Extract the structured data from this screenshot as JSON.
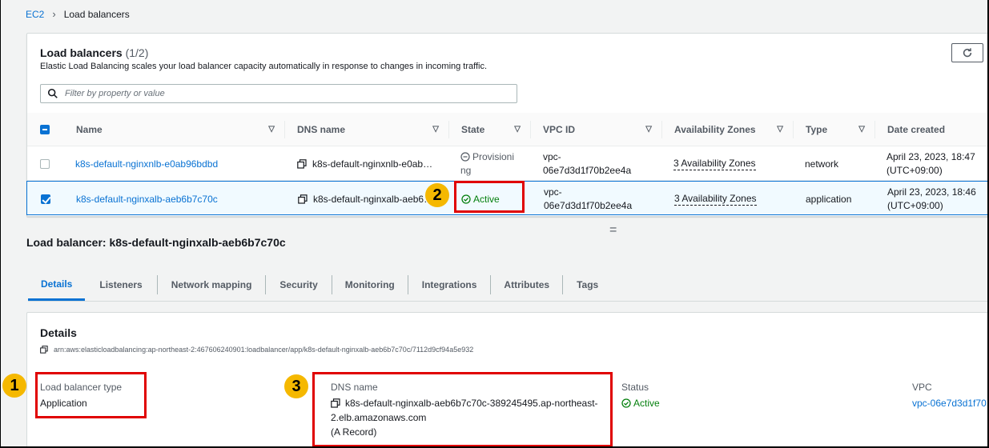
{
  "breadcrumb": {
    "root": "EC2",
    "current": "Load balancers"
  },
  "list": {
    "title": "Load balancers",
    "count": "(1/2)",
    "description": "Elastic Load Balancing scales your load balancer capacity automatically in response to changes in incoming traffic.",
    "filter_placeholder": "Filter by property or value",
    "columns": [
      "Name",
      "DNS name",
      "State",
      "VPC ID",
      "Availability Zones",
      "Type",
      "Date created"
    ],
    "rows": [
      {
        "name": "k8s-default-nginxnlb-e0ab96bdbd",
        "dns": "k8s-default-nginxnlb-e0ab…",
        "state_line1": "Provisioni",
        "state_line2": "ng",
        "vpc_line1": "vpc-",
        "vpc_line2": "06e7d3d1f70b2ee4a",
        "az": "3 Availability Zones",
        "type": "network",
        "date_line1": "April 23, 2023, 18:47",
        "date_line2": "(UTC+09:00)",
        "selected": false
      },
      {
        "name": "k8s-default-nginxalb-aeb6b7c70c",
        "dns": "k8s-default-nginxalb-aeb6…",
        "state": "Active",
        "vpc_line1": "vpc-",
        "vpc_line2": "06e7d3d1f70b2ee4a",
        "az": "3 Availability Zones",
        "type": "application",
        "date_line1": "April 23, 2023, 18:46",
        "date_line2": "(UTC+09:00)",
        "selected": true
      }
    ]
  },
  "detail": {
    "title": "Load balancer: k8s-default-nginxalb-aeb6b7c70c",
    "tabs": [
      "Details",
      "Listeners",
      "Network mapping",
      "Security",
      "Monitoring",
      "Integrations",
      "Attributes",
      "Tags"
    ],
    "section_title": "Details",
    "arn": "arn:aws:elasticloadbalancing:ap-northeast-2:467606240901:loadbalancer/app/k8s-default-nginxalb-aeb6b7c70c/7112d9cf94a5e932",
    "lb_type_label": "Load balancer type",
    "lb_type_value": "Application",
    "dns_label": "DNS name",
    "dns_line1": "k8s-default-nginxalb-aeb6b7c70c-389245495.ap-northeast-",
    "dns_line2": "2.elb.amazonaws.com",
    "dns_line3": "(A Record)",
    "status_label": "Status",
    "status_value": "Active",
    "vpc_label": "VPC",
    "vpc_value": "vpc-06e7d3d1f70"
  },
  "annotations": {
    "badge1": "1",
    "badge2": "2",
    "badge3": "3"
  },
  "colors": {
    "link": "#0972d3",
    "success": "#037f0c",
    "highlight": "#e00000",
    "badge": "#f5b800"
  }
}
